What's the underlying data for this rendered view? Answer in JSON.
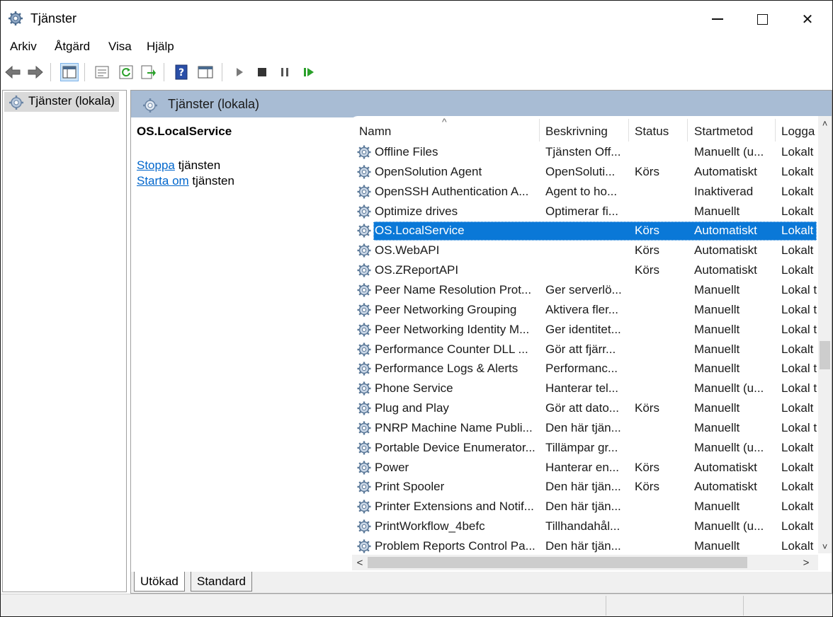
{
  "window": {
    "title": "Tjänster"
  },
  "menu": [
    "Arkiv",
    "Åtgärd",
    "Visa",
    "Hjälp"
  ],
  "toolbar": {
    "icons": [
      "back-arrow-icon",
      "forward-arrow-icon",
      "console-tree-icon",
      "properties-icon",
      "refresh-icon",
      "export-list-icon",
      "help-icon",
      "show-hide-action-pane-icon",
      "play-icon",
      "stop-icon",
      "pause-icon",
      "restart-icon"
    ],
    "colors": {
      "play": "#7a7a7a",
      "stop": "#333333",
      "restart": "#2aa02a",
      "help": "#2a4fa8"
    }
  },
  "tree": {
    "root": "Tjänster (lokala)"
  },
  "panel": {
    "header": "Tjänster (lokala)",
    "description": {
      "service_name": "OS.LocalService",
      "stop_link": "Stoppa",
      "stop_rest": " tjänsten",
      "restart_link": "Starta om",
      "restart_rest": " tjänsten"
    }
  },
  "list": {
    "columns": [
      "Namn",
      "Beskrivning",
      "Status",
      "Startmetod",
      "Logga"
    ],
    "sort_indicator": "^",
    "rows": [
      {
        "name": "Offline Files",
        "desc": "Tjänsten Off...",
        "status": "",
        "start": "Manuellt (u...",
        "log": "Lokalt"
      },
      {
        "name": "OpenSolution Agent",
        "desc": "OpenSoluti...",
        "status": "Körs",
        "start": "Automatiskt",
        "log": "Lokalt"
      },
      {
        "name": "OpenSSH Authentication A...",
        "desc": "Agent to ho...",
        "status": "",
        "start": "Inaktiverad",
        "log": "Lokalt"
      },
      {
        "name": "Optimize drives",
        "desc": "Optimerar fi...",
        "status": "",
        "start": "Manuellt",
        "log": "Lokalt"
      },
      {
        "name": "OS.LocalService",
        "desc": "",
        "status": "Körs",
        "start": "Automatiskt",
        "log": "Lokalt",
        "selected": true
      },
      {
        "name": "OS.WebAPI",
        "desc": "",
        "status": "Körs",
        "start": "Automatiskt",
        "log": "Lokalt"
      },
      {
        "name": "OS.ZReportAPI",
        "desc": "",
        "status": "Körs",
        "start": "Automatiskt",
        "log": "Lokalt"
      },
      {
        "name": "Peer Name Resolution Prot...",
        "desc": "Ger serverlö...",
        "status": "",
        "start": "Manuellt",
        "log": "Lokal t"
      },
      {
        "name": "Peer Networking Grouping",
        "desc": "Aktivera fler...",
        "status": "",
        "start": "Manuellt",
        "log": "Lokal t"
      },
      {
        "name": "Peer Networking Identity M...",
        "desc": "Ger identitet...",
        "status": "",
        "start": "Manuellt",
        "log": "Lokal t"
      },
      {
        "name": "Performance Counter DLL ...",
        "desc": "Gör att fjärr...",
        "status": "",
        "start": "Manuellt",
        "log": "Lokalt"
      },
      {
        "name": "Performance Logs & Alerts",
        "desc": "Performanc...",
        "status": "",
        "start": "Manuellt",
        "log": "Lokal t"
      },
      {
        "name": "Phone Service",
        "desc": "Hanterar tel...",
        "status": "",
        "start": "Manuellt (u...",
        "log": "Lokal t"
      },
      {
        "name": "Plug and Play",
        "desc": "Gör att dato...",
        "status": "Körs",
        "start": "Manuellt",
        "log": "Lokalt"
      },
      {
        "name": "PNRP Machine Name Publi...",
        "desc": "Den här tjän...",
        "status": "",
        "start": "Manuellt",
        "log": "Lokal t"
      },
      {
        "name": "Portable Device Enumerator...",
        "desc": "Tillämpar gr...",
        "status": "",
        "start": "Manuellt (u...",
        "log": "Lokalt"
      },
      {
        "name": "Power",
        "desc": "Hanterar en...",
        "status": "Körs",
        "start": "Automatiskt",
        "log": "Lokalt"
      },
      {
        "name": "Print Spooler",
        "desc": "Den här tjän...",
        "status": "Körs",
        "start": "Automatiskt",
        "log": "Lokalt"
      },
      {
        "name": "Printer Extensions and Notif...",
        "desc": "Den här tjän...",
        "status": "",
        "start": "Manuellt",
        "log": "Lokalt"
      },
      {
        "name": "PrintWorkflow_4befc",
        "desc": "Tillhandahål...",
        "status": "",
        "start": "Manuellt (u...",
        "log": "Lokalt"
      },
      {
        "name": "Problem Reports Control Pa...",
        "desc": "Den här tjän...",
        "status": "",
        "start": "Manuellt",
        "log": "Lokalt"
      }
    ],
    "selection_color": "#0a78d7"
  },
  "tabs": [
    "Utökad",
    "Standard"
  ],
  "scroll": {
    "up": "˄",
    "down": "˅",
    "left": "<",
    "right": ">"
  },
  "title_buttons": {
    "close": "✕"
  }
}
